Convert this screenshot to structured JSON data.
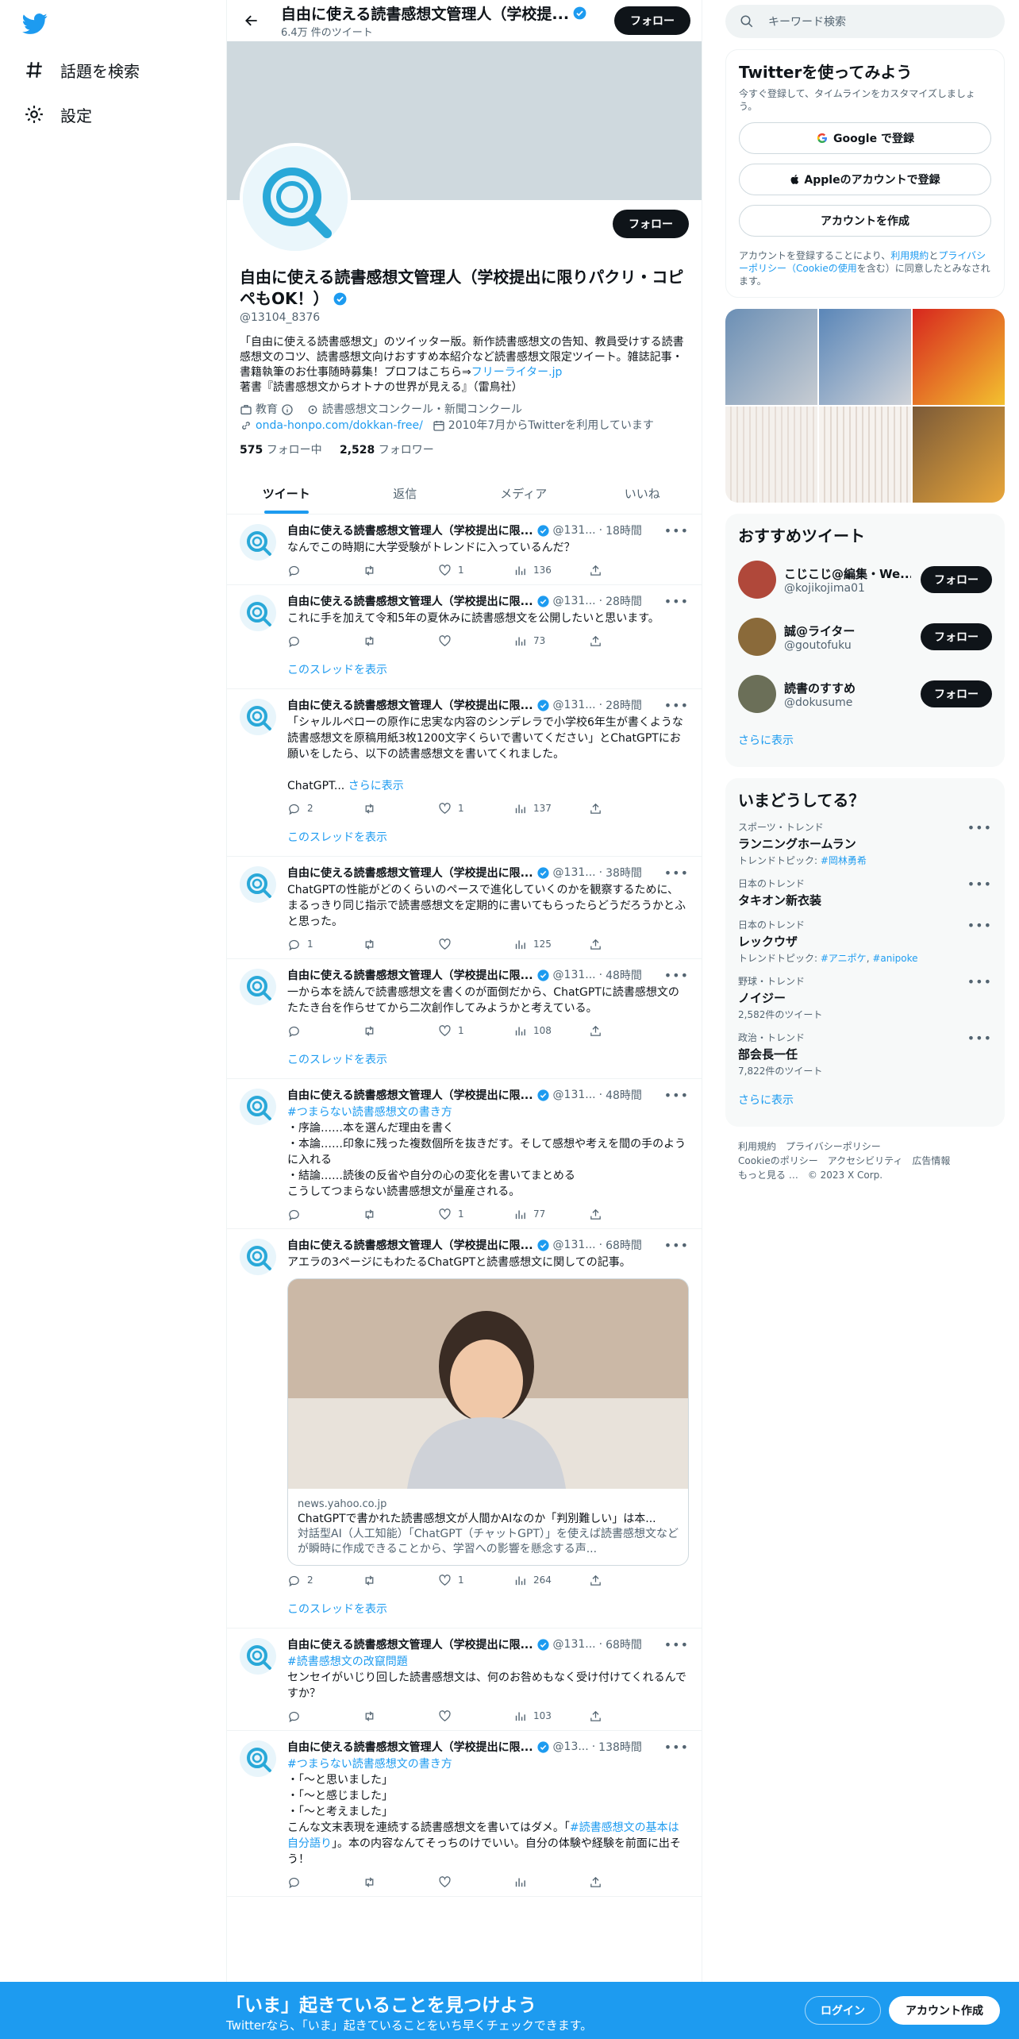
{
  "nav": {
    "explore": "話題を検索",
    "settings": "設定"
  },
  "topbar": {
    "name": "自由に使える読書感想文管理人（学校提...",
    "count": "6.4万 件のツイート",
    "follow": "フォロー"
  },
  "profile": {
    "follow": "フォロー",
    "name": "自由に使える読書感想文管理人（学校提出に限りパクリ・コピペもOK！）",
    "handle": "@13104_8376",
    "bio_before": "「自由に使える読書感想文」のツイッター版。新作読書感想文の告知、教員受けする読書感想文のコツ、読書感想文向けおすすめ本紹介など読書感想文限定ツイート。雑誌記事・書籍執筆のお仕事随時募集！プロフはこちら⇒",
    "bio_link": "フリーライター.jp",
    "bio_after": "著書『読書感想文からオトナの世界が見える』（雷鳥社）",
    "category": "教育",
    "location": "読書感想文コンクール・新聞コンクール",
    "url": "onda-honpo.com/dokkan-free/",
    "joined": "2010年7月からTwitterを利用しています",
    "following_count": "575",
    "following_label": "フォロー中",
    "followers_count": "2,528",
    "followers_label": "フォロワー"
  },
  "tabs": [
    "ツイート",
    "返信",
    "メディア",
    "いいね"
  ],
  "tweets": [
    {
      "name": "自由に使える読書感想文管理人（学校提出に限...",
      "handle": "@131...",
      "time": "18時間",
      "text": "なんでこの時期に大学受験がトレンドに入っているんだ？",
      "reply": "",
      "rt": "",
      "like": "1",
      "views": "136",
      "thread": ""
    },
    {
      "name": "自由に使える読書感想文管理人（学校提出に限...",
      "handle": "@131...",
      "time": "28時間",
      "text": "これに手を加えて令和5年の夏休みに読書感想文を公開したいと思います。",
      "reply": "",
      "rt": "",
      "like": "",
      "views": "73",
      "thread": "このスレッドを表示"
    },
    {
      "name": "自由に使える読書感想文管理人（学校提出に限...",
      "handle": "@131...",
      "time": "28時間",
      "text": "「シャルルペローの原作に忠実な内容のシンデレラで小学校6年生が書くような読書感想文を原稿用紙3枚1200文字くらいで書いてください」とChatGPTにお願いをしたら、以下の読書感想文を書いてくれました。\n\nChatGPT...",
      "more": "さらに表示",
      "reply": "2",
      "rt": "",
      "like": "1",
      "views": "137",
      "thread": "このスレッドを表示"
    },
    {
      "name": "自由に使える読書感想文管理人（学校提出に限...",
      "handle": "@131...",
      "time": "38時間",
      "text": "ChatGPTの性能がどのくらいのペースで進化していくのかを観察するために、まるっきり同じ指示で読書感想文を定期的に書いてもらったらどうだろうかとふと思った。",
      "reply": "1",
      "rt": "",
      "like": "",
      "views": "125",
      "thread": ""
    },
    {
      "name": "自由に使える読書感想文管理人（学校提出に限...",
      "handle": "@131...",
      "time": "48時間",
      "text": "一から本を読んで読書感想文を書くのが面倒だから、ChatGPTに読書感想文のたたき台を作らせてから二次創作してみようかと考えている。",
      "reply": "",
      "rt": "",
      "like": "1",
      "views": "108",
      "thread": "このスレッドを表示"
    },
    {
      "name": "自由に使える読書感想文管理人（学校提出に限...",
      "handle": "@131...",
      "time": "48時間",
      "hashtag": "#つまらない読書感想文の書き方",
      "text": "・序論……本を選んだ理由を書く\n・本論……印象に残った複数個所を抜きだす。そして感想や考えを間の手のように入れる\n・結論……読後の反省や自分の心の変化を書いてまとめる\nこうしてつまらない読書感想文が量産される。",
      "reply": "",
      "rt": "",
      "like": "1",
      "views": "77",
      "thread": ""
    },
    {
      "name": "自由に使える読書感想文管理人（学校提出に限...",
      "handle": "@131...",
      "time": "68時間",
      "text": "アエラの3ページにもわたるChatGPTと読書感想文に関しての記事。",
      "card": {
        "domain": "news.yahoo.co.jp",
        "title": "ChatGPTで書かれた読書感想文が人間かAIなのか「判別難しい」は本...",
        "desc": "対話型AI（人工知能）「ChatGPT（チャットGPT）」を使えば読書感想文などが瞬時に作成できることから、学習への影響を懸念する声..."
      },
      "reply": "2",
      "rt": "",
      "like": "1",
      "views": "264",
      "thread": "このスレッドを表示"
    },
    {
      "name": "自由に使える読書感想文管理人（学校提出に限...",
      "handle": "@131...",
      "time": "68時間",
      "hashtag": "#読書感想文の改竄問題",
      "text": "センセイがいじり回した読書感想文は、何のお咎めもなく受け付けてくれるんですか？",
      "reply": "",
      "rt": "",
      "like": "",
      "views": "103",
      "thread": ""
    },
    {
      "name": "自由に使える読書感想文管理人（学校提出に限...",
      "handle": "@13...",
      "time": "138時間",
      "hashtag": "#つまらない読書感想文の書き方",
      "text": "・「～と思いました」\n・「～と感じました」\n・「～と考えました」\nこんな文末表現を連続する読書感想文を書いてはダメ。「",
      "hashtag2": "#読書感想文の基本は自分語り",
      "text2": "」。本の内容なんてそっちのけでいい。自分の体験や経験を前面に出そう！",
      "reply": "",
      "rt": "",
      "like": "",
      "views": "",
      "thread": ""
    }
  ],
  "right": {
    "search_placeholder": "キーワード検索",
    "join_title": "Twitterを使ってみよう",
    "join_sub": "今すぐ登録して、タイムラインをカスタマイズしましょう。",
    "google_btn": "Google で登録",
    "apple_btn": "Appleのアカウントで登録",
    "create_btn": "アカウントを作成",
    "legal_a": "アカウントを登録することにより、",
    "legal_terms": "利用規約",
    "legal_b": "と",
    "legal_privacy": "プライバシーポリシー（Cookieの使用",
    "legal_c": "を含む）に同意したとみなされます。",
    "who_title": "おすすめツイート",
    "who": [
      {
        "name": "こじこじ@編集・We...",
        "handle": "@kojikojima01",
        "follow": "フォロー",
        "color": "#b0483a"
      },
      {
        "name": "誠@ライター",
        "handle": "@goutofuku",
        "follow": "フォロー",
        "color": "#8a6a3a"
      },
      {
        "name": "読書のすすめ",
        "handle": "@dokusume",
        "follow": "フォロー",
        "color": "#6b6f58"
      }
    ],
    "who_more": "さらに表示",
    "trends_title": "いまどうしてる？",
    "trends": [
      {
        "cat": "スポーツ・トレンド",
        "name": "ランニングホームラン",
        "sub_label": "トレンドトピック: ",
        "sub_link": "#岡林勇希",
        "sub_link2": ""
      },
      {
        "cat": "日本のトレンド",
        "name": "タキオン新衣装",
        "sub_label": "",
        "sub_link": "",
        "sub_link2": ""
      },
      {
        "cat": "日本のトレンド",
        "name": "レックウザ",
        "sub_label": "トレンドトピック: ",
        "sub_link": "#アニポケ",
        "sub_link2": "#anipoke"
      },
      {
        "cat": "野球・トレンド",
        "name": "ノイジー",
        "sub_label": "2,582件のツイート",
        "sub_link": "",
        "sub_link2": ""
      },
      {
        "cat": "政治・トレンド",
        "name": "部会長一任",
        "sub_label": "7,822件のツイート",
        "sub_link": "",
        "sub_link2": ""
      }
    ],
    "trends_more": "さらに表示",
    "footer": [
      "利用規約",
      "プライバシーポリシー",
      "Cookieのポリシー",
      "アクセシビリティ",
      "広告情報",
      "もっと見る …",
      "© 2023 X Corp."
    ]
  },
  "bottom": {
    "title": "「いま」起きていることを見つけよう",
    "sub": "Twitterなら、「いま」起きていることをいち早くチェックできます。",
    "login": "ログイン",
    "signup": "アカウント作成"
  }
}
